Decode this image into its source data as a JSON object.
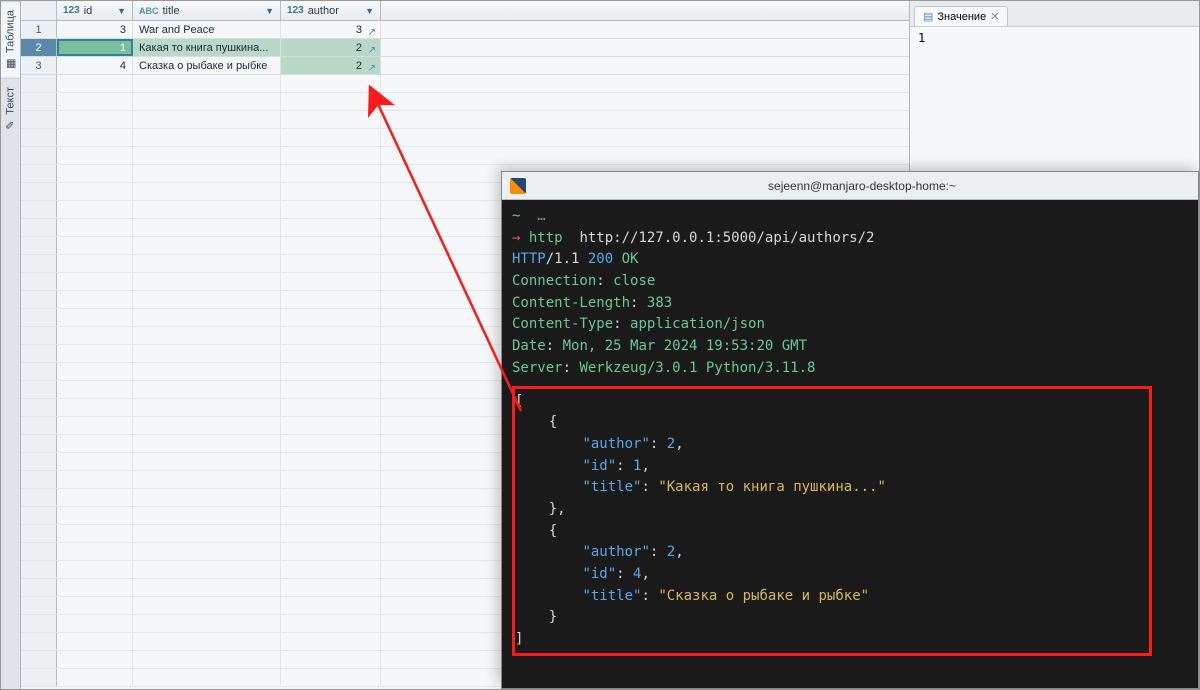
{
  "side_tabs": {
    "tablitsa": "Таблица",
    "tekst": "Текст"
  },
  "columns": {
    "id": {
      "type_prefix": "123",
      "name": "id"
    },
    "title": {
      "type_prefix": "ABC",
      "name": "title"
    },
    "author": {
      "type_prefix": "123",
      "name": "author"
    }
  },
  "rows": [
    {
      "n": "1",
      "id": "3",
      "title": "War and Peace",
      "author": "3"
    },
    {
      "n": "2",
      "id": "1",
      "title": "Какая то книга пушкина...",
      "author": "2"
    },
    {
      "n": "3",
      "id": "4",
      "title": "Сказка о рыбаке и рыбке",
      "author": "2"
    }
  ],
  "right_panel": {
    "tab_label": "Значение",
    "value": "1"
  },
  "terminal": {
    "title": "sejeenn@manjaro-desktop-home:~",
    "prompt_tilde": "~",
    "prompt_dots": "…",
    "arrow": "→",
    "cmd_program": "http",
    "cmd_url": "http://127.0.0.1:5000/api/authors/2",
    "status_proto": "HTTP",
    "status_ver": "/1.1",
    "status_code": "200",
    "status_text": "OK",
    "headers": [
      {
        "k": "Connection",
        "v": "close"
      },
      {
        "k": "Content-Length",
        "v": "383"
      },
      {
        "k": "Content-Type",
        "v": "application/json"
      },
      {
        "k": "Date",
        "v": "Mon, 25 Mar 2024 19:53:20 GMT"
      },
      {
        "k": "Server",
        "v": "Werkzeug/3.0.1 Python/3.11.8"
      }
    ],
    "json": {
      "bracket_open": "[",
      "brace_open": "{",
      "brace_close": "}",
      "comma": ",",
      "bracket_close": "]",
      "key_author": "\"author\"",
      "key_id": "\"id\"",
      "key_title": "\"title\"",
      "colon": ":",
      "obj1_author": "2",
      "obj1_id": "1",
      "obj1_title": "\"Какая то книга пушкина...\"",
      "obj2_author": "2",
      "obj2_id": "4",
      "obj2_title": "\"Сказка о рыбаке и рыбке\""
    }
  }
}
